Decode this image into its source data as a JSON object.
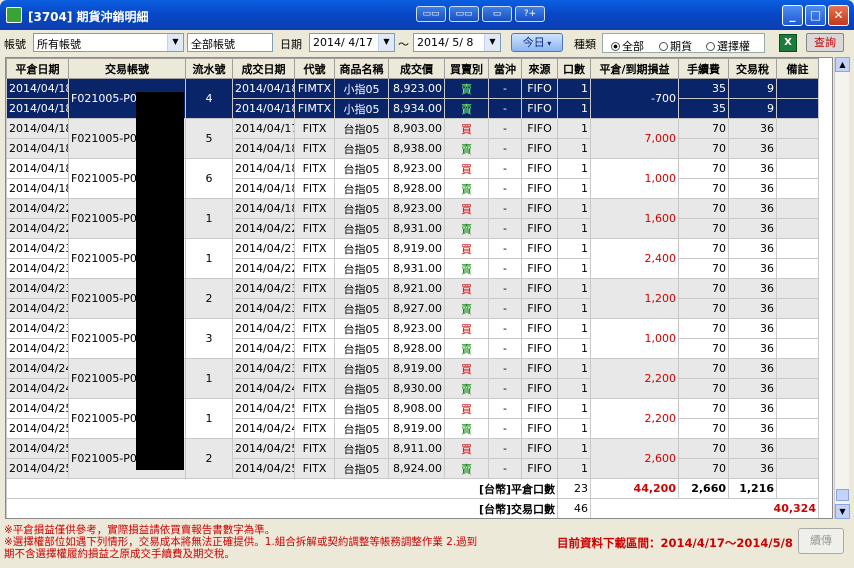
{
  "window": {
    "title": "[3704] 期貨沖銷明細",
    "toolbar_icons": [
      "window-tile-icon",
      "window-cascade-icon",
      "window-fit-icon",
      "help-icon"
    ],
    "tb_labels": [
      "▭▭",
      "▭▭",
      "▭",
      "?+"
    ]
  },
  "filters": {
    "account_label": "帳號",
    "account_value": "所有帳號",
    "account_name": "全部帳號",
    "date_label": "日期",
    "date_from": "2014/ 4/17",
    "date_sep": "〜",
    "date_to": "2014/ 5/ 8",
    "today_button": "今日",
    "type_label": "種類",
    "type_options": [
      "全部",
      "期貨",
      "選擇權"
    ],
    "type_selected": "全部",
    "excel_label": "X",
    "query_button": "查詢"
  },
  "table": {
    "columns": [
      "平倉日期",
      "交易帳號",
      "流水號",
      "成交日期",
      "代號",
      "商品名稱",
      "成交價",
      "買賣別",
      "當沖",
      "來源",
      "口數",
      "平倉/到期損益",
      "手續費",
      "交易稅",
      "備註"
    ],
    "groups": [
      {
        "serial": "4",
        "account": "F021005-P05",
        "pl": "-700",
        "selected": true,
        "rows": [
          {
            "close_date": "2014/04/18",
            "trade_date": "2014/04/18",
            "code": "FIMTX",
            "product": "小指05",
            "price": "8,923.00",
            "side": "賣",
            "daytrade": "-",
            "source": "FIFO",
            "qty": "1",
            "fee": "35",
            "tax": "9"
          },
          {
            "close_date": "2014/04/18",
            "trade_date": "2014/04/18",
            "code": "FIMTX",
            "product": "小指05",
            "price": "8,934.00",
            "side": "賣",
            "daytrade": "-",
            "source": "FIFO",
            "qty": "1",
            "fee": "35",
            "tax": "9"
          }
        ]
      },
      {
        "serial": "5",
        "account": "F021005-P05",
        "pl": "7,000",
        "selected": false,
        "rows": [
          {
            "close_date": "2014/04/18",
            "trade_date": "2014/04/17",
            "code": "FITX",
            "product": "台指05",
            "price": "8,903.00",
            "side": "買",
            "daytrade": "-",
            "source": "FIFO",
            "qty": "1",
            "fee": "70",
            "tax": "36"
          },
          {
            "close_date": "2014/04/18",
            "trade_date": "2014/04/18",
            "code": "FITX",
            "product": "台指05",
            "price": "8,938.00",
            "side": "賣",
            "daytrade": "-",
            "source": "FIFO",
            "qty": "1",
            "fee": "70",
            "tax": "36"
          }
        ]
      },
      {
        "serial": "6",
        "account": "F021005-P05",
        "pl": "1,000",
        "selected": false,
        "rows": [
          {
            "close_date": "2014/04/18",
            "trade_date": "2014/04/18",
            "code": "FITX",
            "product": "台指05",
            "price": "8,923.00",
            "side": "買",
            "daytrade": "-",
            "source": "FIFO",
            "qty": "1",
            "fee": "70",
            "tax": "36"
          },
          {
            "close_date": "2014/04/18",
            "trade_date": "2014/04/18",
            "code": "FITX",
            "product": "台指05",
            "price": "8,928.00",
            "side": "賣",
            "daytrade": "-",
            "source": "FIFO",
            "qty": "1",
            "fee": "70",
            "tax": "36"
          }
        ]
      },
      {
        "serial": "1",
        "account": "F021005-P05",
        "pl": "1,600",
        "selected": false,
        "rows": [
          {
            "close_date": "2014/04/22",
            "trade_date": "2014/04/18",
            "code": "FITX",
            "product": "台指05",
            "price": "8,923.00",
            "side": "買",
            "daytrade": "-",
            "source": "FIFO",
            "qty": "1",
            "fee": "70",
            "tax": "36"
          },
          {
            "close_date": "2014/04/22",
            "trade_date": "2014/04/22",
            "code": "FITX",
            "product": "台指05",
            "price": "8,931.00",
            "side": "賣",
            "daytrade": "-",
            "source": "FIFO",
            "qty": "1",
            "fee": "70",
            "tax": "36"
          }
        ]
      },
      {
        "serial": "1",
        "account": "F021005-P05",
        "pl": "2,400",
        "selected": false,
        "rows": [
          {
            "close_date": "2014/04/23",
            "trade_date": "2014/04/23",
            "code": "FITX",
            "product": "台指05",
            "price": "8,919.00",
            "side": "買",
            "daytrade": "-",
            "source": "FIFO",
            "qty": "1",
            "fee": "70",
            "tax": "36"
          },
          {
            "close_date": "2014/04/23",
            "trade_date": "2014/04/22",
            "code": "FITX",
            "product": "台指05",
            "price": "8,931.00",
            "side": "賣",
            "daytrade": "-",
            "source": "FIFO",
            "qty": "1",
            "fee": "70",
            "tax": "36"
          }
        ]
      },
      {
        "serial": "2",
        "account": "F021005-P05",
        "pl": "1,200",
        "selected": false,
        "rows": [
          {
            "close_date": "2014/04/23",
            "trade_date": "2014/04/23",
            "code": "FITX",
            "product": "台指05",
            "price": "8,921.00",
            "side": "買",
            "daytrade": "-",
            "source": "FIFO",
            "qty": "1",
            "fee": "70",
            "tax": "36"
          },
          {
            "close_date": "2014/04/23",
            "trade_date": "2014/04/23",
            "code": "FITX",
            "product": "台指05",
            "price": "8,927.00",
            "side": "賣",
            "daytrade": "-",
            "source": "FIFO",
            "qty": "1",
            "fee": "70",
            "tax": "36"
          }
        ]
      },
      {
        "serial": "3",
        "account": "F021005-P05",
        "pl": "1,000",
        "selected": false,
        "rows": [
          {
            "close_date": "2014/04/23",
            "trade_date": "2014/04/23",
            "code": "FITX",
            "product": "台指05",
            "price": "8,923.00",
            "side": "買",
            "daytrade": "-",
            "source": "FIFO",
            "qty": "1",
            "fee": "70",
            "tax": "36"
          },
          {
            "close_date": "2014/04/23",
            "trade_date": "2014/04/23",
            "code": "FITX",
            "product": "台指05",
            "price": "8,928.00",
            "side": "賣",
            "daytrade": "-",
            "source": "FIFO",
            "qty": "1",
            "fee": "70",
            "tax": "36"
          }
        ]
      },
      {
        "serial": "1",
        "account": "F021005-P05",
        "pl": "2,200",
        "selected": false,
        "rows": [
          {
            "close_date": "2014/04/24",
            "trade_date": "2014/04/23",
            "code": "FITX",
            "product": "台指05",
            "price": "8,919.00",
            "side": "買",
            "daytrade": "-",
            "source": "FIFO",
            "qty": "1",
            "fee": "70",
            "tax": "36"
          },
          {
            "close_date": "2014/04/24",
            "trade_date": "2014/04/24",
            "code": "FITX",
            "product": "台指05",
            "price": "8,930.00",
            "side": "賣",
            "daytrade": "-",
            "source": "FIFO",
            "qty": "1",
            "fee": "70",
            "tax": "36"
          }
        ]
      },
      {
        "serial": "1",
        "account": "F021005-P05",
        "pl": "2,200",
        "selected": false,
        "rows": [
          {
            "close_date": "2014/04/25",
            "trade_date": "2014/04/25",
            "code": "FITX",
            "product": "台指05",
            "price": "8,908.00",
            "side": "買",
            "daytrade": "-",
            "source": "FIFO",
            "qty": "1",
            "fee": "70",
            "tax": "36"
          },
          {
            "close_date": "2014/04/25",
            "trade_date": "2014/04/24",
            "code": "FITX",
            "product": "台指05",
            "price": "8,919.00",
            "side": "賣",
            "daytrade": "-",
            "source": "FIFO",
            "qty": "1",
            "fee": "70",
            "tax": "36"
          }
        ]
      },
      {
        "serial": "2",
        "account": "F021005-P05",
        "pl": "2,600",
        "selected": false,
        "rows": [
          {
            "close_date": "2014/04/25",
            "trade_date": "2014/04/25",
            "code": "FITX",
            "product": "台指05",
            "price": "8,911.00",
            "side": "買",
            "daytrade": "-",
            "source": "FIFO",
            "qty": "1",
            "fee": "70",
            "tax": "36"
          },
          {
            "close_date": "2014/04/25",
            "trade_date": "2014/04/25",
            "code": "FITX",
            "product": "台指05",
            "price": "8,924.00",
            "side": "賣",
            "daytrade": "-",
            "source": "FIFO",
            "qty": "1",
            "fee": "70",
            "tax": "36"
          }
        ]
      }
    ],
    "summary": {
      "close_label": "[台幣]平倉口數",
      "close_qty": "23",
      "close_pl": "44,200",
      "close_fee": "2,660",
      "close_tax": "1,216",
      "trade_label": "[台幣]交易口數",
      "trade_qty": "46",
      "trade_pl": "40,324"
    }
  },
  "footer": {
    "note1": "※平倉損益僅供參考，實際損益請依買賣報告書數字為準。",
    "note2": "※選擇權部位如遇下列情形，交易成本將無法正確提供。1.組合拆解或契約調整等帳務調整作業 2.過到",
    "note3": "期不含選擇權履約損益之原成交手續費及期交稅。",
    "range": "目前資料下載區間：2014/4/17〜2014/5/8",
    "continue_button": "續傳"
  },
  "colors": {
    "title_bar": "#0a4fd0",
    "selected_row": "#0a246a",
    "buy": "#d00000",
    "sell": "#008000",
    "profit": "#d00000"
  }
}
